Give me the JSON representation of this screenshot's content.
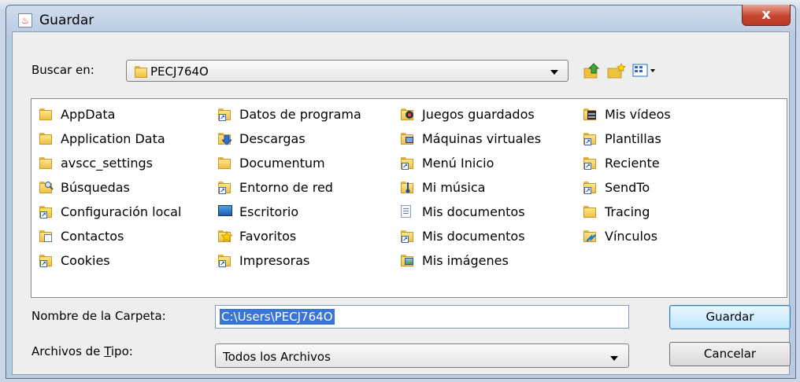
{
  "window": {
    "title": "Guardar",
    "close_glyph": "x"
  },
  "lookin": {
    "label": "Buscar en:",
    "value": "PECJ764O"
  },
  "toolbar": {
    "up_icon": "up-folder-icon",
    "new_folder_icon": "new-folder-icon",
    "view_icon": "view-menu-icon"
  },
  "files": {
    "col1": [
      {
        "label": "AppData",
        "icon": "folder"
      },
      {
        "label": "Application Data",
        "icon": "folder"
      },
      {
        "label": "avscc_settings",
        "icon": "folder"
      },
      {
        "label": "Búsquedas",
        "icon": "search-folder"
      },
      {
        "label": "Configuración local",
        "icon": "shortcut"
      },
      {
        "label": "Contactos",
        "icon": "contacts"
      },
      {
        "label": "Cookies",
        "icon": "shortcut"
      }
    ],
    "col2": [
      {
        "label": "Datos de programa",
        "icon": "shortcut"
      },
      {
        "label": "Descargas",
        "icon": "downloads"
      },
      {
        "label": "Documentum",
        "icon": "folder"
      },
      {
        "label": "Entorno de red",
        "icon": "shortcut"
      },
      {
        "label": "Escritorio",
        "icon": "desktop"
      },
      {
        "label": "Favoritos",
        "icon": "favorites"
      },
      {
        "label": "Impresoras",
        "icon": "shortcut"
      }
    ],
    "col3": [
      {
        "label": "Juegos guardados",
        "icon": "games"
      },
      {
        "label": "Máquinas virtuales",
        "icon": "vm"
      },
      {
        "label": "Menú Inicio",
        "icon": "shortcut"
      },
      {
        "label": "Mi música",
        "icon": "music"
      },
      {
        "label": "Mis documentos",
        "icon": "document"
      },
      {
        "label": "Mis documentos",
        "icon": "shortcut"
      },
      {
        "label": "Mis imágenes",
        "icon": "pictures"
      }
    ],
    "col4": [
      {
        "label": "Mis vídeos",
        "icon": "videos"
      },
      {
        "label": "Plantillas",
        "icon": "shortcut"
      },
      {
        "label": "Reciente",
        "icon": "shortcut"
      },
      {
        "label": "SendTo",
        "icon": "shortcut"
      },
      {
        "label": "Tracing",
        "icon": "folder"
      },
      {
        "label": "Vínculos",
        "icon": "links"
      }
    ]
  },
  "filename": {
    "label": "Nombre de la Carpeta:",
    "value": "C:\\Users\\PECJ764O"
  },
  "filetype": {
    "label_pre": "Archivos de ",
    "label_mnemonic": "T",
    "label_post": "ipo:",
    "value": "Todos los Archivos"
  },
  "buttons": {
    "save": "Guardar",
    "cancel": "Cancelar"
  }
}
